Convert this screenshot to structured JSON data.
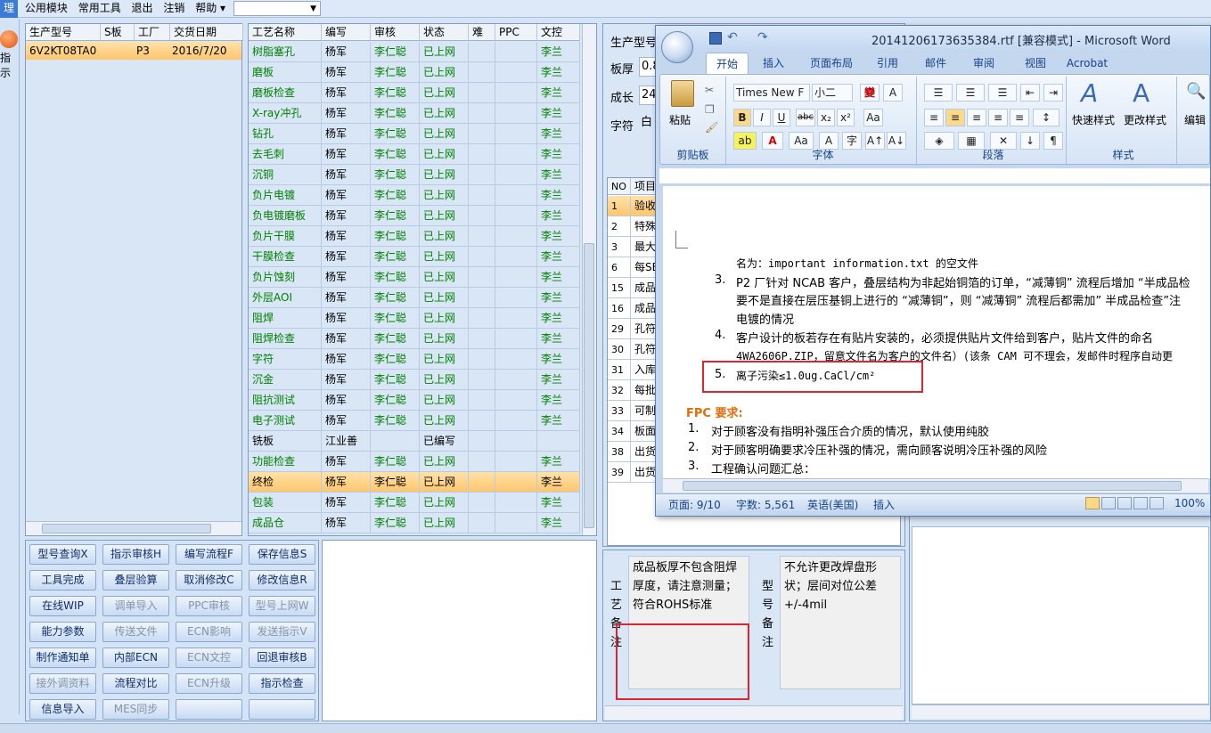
{
  "menubar": {
    "items": [
      "理",
      "公用模块",
      "常用工具",
      "退出",
      "注销",
      "帮助"
    ]
  },
  "leftstrip": {
    "label": "指示"
  },
  "orders": {
    "headers": [
      "生产型号",
      "S板",
      "工厂",
      "交货日期"
    ],
    "rows": [
      [
        "6V2KT08TA0",
        "",
        "P3",
        "2016/7/20"
      ]
    ]
  },
  "process": {
    "headers": [
      "工艺名称",
      "编写",
      "审核",
      "状态",
      "难",
      "PPC",
      "文控"
    ],
    "rows": [
      [
        "树脂塞孔",
        "杨军",
        "李仁聪",
        "已上网",
        "",
        "",
        "李兰"
      ],
      [
        "磨板",
        "杨军",
        "李仁聪",
        "已上网",
        "",
        "",
        "李兰"
      ],
      [
        "磨板检查",
        "杨军",
        "李仁聪",
        "已上网",
        "",
        "",
        "李兰"
      ],
      [
        "X-ray冲孔",
        "杨军",
        "李仁聪",
        "已上网",
        "",
        "",
        "李兰"
      ],
      [
        "钻孔",
        "杨军",
        "李仁聪",
        "已上网",
        "",
        "",
        "李兰"
      ],
      [
        "去毛刺",
        "杨军",
        "李仁聪",
        "已上网",
        "",
        "",
        "李兰"
      ],
      [
        "沉铜",
        "杨军",
        "李仁聪",
        "已上网",
        "",
        "",
        "李兰"
      ],
      [
        "负片电镀",
        "杨军",
        "李仁聪",
        "已上网",
        "",
        "",
        "李兰"
      ],
      [
        "负电镀磨板",
        "杨军",
        "李仁聪",
        "已上网",
        "",
        "",
        "李兰"
      ],
      [
        "负片干膜",
        "杨军",
        "李仁聪",
        "已上网",
        "",
        "",
        "李兰"
      ],
      [
        "干膜检查",
        "杨军",
        "李仁聪",
        "已上网",
        "",
        "",
        "李兰"
      ],
      [
        "负片蚀刻",
        "杨军",
        "李仁聪",
        "已上网",
        "",
        "",
        "李兰"
      ],
      [
        "外层AOI",
        "杨军",
        "李仁聪",
        "已上网",
        "",
        "",
        "李兰"
      ],
      [
        "阻焊",
        "杨军",
        "李仁聪",
        "已上网",
        "",
        "",
        "李兰"
      ],
      [
        "阻焊检查",
        "杨军",
        "李仁聪",
        "已上网",
        "",
        "",
        "李兰"
      ],
      [
        "字符",
        "杨军",
        "李仁聪",
        "已上网",
        "",
        "",
        "李兰"
      ],
      [
        "沉金",
        "杨军",
        "李仁聪",
        "已上网",
        "",
        "",
        "李兰"
      ],
      [
        "阻抗测试",
        "杨军",
        "李仁聪",
        "已上网",
        "",
        "",
        "李兰"
      ],
      [
        "电子测试",
        "杨军",
        "李仁聪",
        "已上网",
        "",
        "",
        "李兰"
      ],
      [
        "铣板",
        "江业善",
        "",
        "已编写",
        "",
        "",
        ""
      ],
      [
        "功能检查",
        "杨军",
        "李仁聪",
        "已上网",
        "",
        "",
        "李兰"
      ],
      [
        "终检",
        "杨军",
        "李仁聪",
        "已上网",
        "",
        "",
        "李兰"
      ],
      [
        "包装",
        "杨军",
        "李仁聪",
        "已上网",
        "",
        "",
        "李兰"
      ],
      [
        "成品仓",
        "杨军",
        "李仁聪",
        "已上网",
        "",
        "",
        "李兰"
      ]
    ],
    "selected_row": 21
  },
  "buttons": [
    [
      "型号查询X",
      "指示审核H",
      "编写流程F",
      "保存信息S"
    ],
    [
      "工具完成",
      "叠层验算",
      "取消修改C",
      "修改信息R"
    ],
    [
      "在线WIP",
      "调单导入",
      "PPC审核",
      "型号上网W"
    ],
    [
      "能力参数",
      "传送文件",
      "ECN影响",
      "发送指示V"
    ],
    [
      "制作通知单",
      "内部ECN",
      "ECN文控",
      "回退审核B"
    ],
    [
      "接外调资料",
      "流程对比",
      "ECN升级",
      "指示检查"
    ],
    [
      "信息导入",
      "MES同步",
      "",
      ""
    ]
  ],
  "disabled_buttons": [
    "调单导入",
    "PPC审核",
    "型号上网W",
    "传送文件",
    "ECN影响",
    "发送指示V",
    "ECN文控",
    "接外调资料",
    "ECN升级",
    "MES同步"
  ],
  "mid": {
    "labels": [
      "生产型号",
      "板厚",
      "成长",
      "字符"
    ],
    "values": [
      "",
      "0.8",
      "24",
      "白"
    ],
    "table_headers": [
      "NO",
      "项目"
    ],
    "rows": [
      [
        "1",
        "验收"
      ],
      [
        "2",
        "特殊"
      ],
      [
        "3",
        "最大"
      ],
      [
        "6",
        "每SE"
      ],
      [
        "15",
        "成品"
      ],
      [
        "16",
        "成品"
      ],
      [
        "29",
        "孔符"
      ],
      [
        "30",
        "孔符"
      ],
      [
        "31",
        "入库"
      ],
      [
        "32",
        "每批"
      ],
      [
        "33",
        "可制"
      ],
      [
        "34",
        "板面"
      ],
      [
        "38",
        "出货"
      ],
      [
        "39",
        "出货"
      ]
    ],
    "process_note_label": "工艺备注",
    "process_note": "成品板厚不包含阻焊厚度，请注意测量；符合ROHS标准",
    "model_note_label": "型号备注",
    "model_note": "不允许更改焊盘形状；层间对位公差+/-4mil"
  },
  "word": {
    "title": "20141206173635384.rtf [兼容模式] - Microsoft Word",
    "tabs": [
      "开始",
      "插入",
      "页面布局",
      "引用",
      "邮件",
      "审阅",
      "视图",
      "Acrobat"
    ],
    "groups": [
      "剪贴板",
      "字体",
      "段落",
      "样式"
    ],
    "paste": "粘贴",
    "font_name": "Times New F",
    "font_size": "小二",
    "quick_style": "快速样式",
    "change_style": "更改样式",
    "edit": "编辑",
    "doc_lines": [
      "名为：important information.txt 的空文件",
      "P2 厂针对 NCAB 客户，叠层结构为非起始铜箔的订单，“减薄铜” 流程后增加 “半成品检",
      "要不是直接在层压基铜上进行的 “减薄铜”，则 “减薄铜” 流程后都需加” 半成品检查”注",
      "电镀的情况",
      "客户设计的板若存在有贴片安装的，必须提供贴片文件给到客户，贴片文件的命名",
      "4WA2606P.ZIP，留意文件名为客户的文件名）(该条 CAM 可不理会，发邮件时程序自动更",
      "离子污染≤1.0ug.CaCl/cm²",
      "FPC 要求:",
      "对于顾客没有指明补强压合介质的情况，默认使用纯胶",
      "对于顾客明确要求冷压补强的情况，需向顾客说明冷压补强的风险",
      "工程确认问题汇总："
    ],
    "list_numbers": [
      "3.",
      "4.",
      "5.",
      "1.",
      "2.",
      "3."
    ],
    "status": {
      "page": "页面: 9/10",
      "words": "字数: 5,561",
      "lang": "英语(美国)",
      "mode": "插入",
      "zoom": "100%"
    }
  },
  "colors": {
    "accent": "#e0232f",
    "green_text": "#008000",
    "fpc_heading": "#e46c0a"
  }
}
